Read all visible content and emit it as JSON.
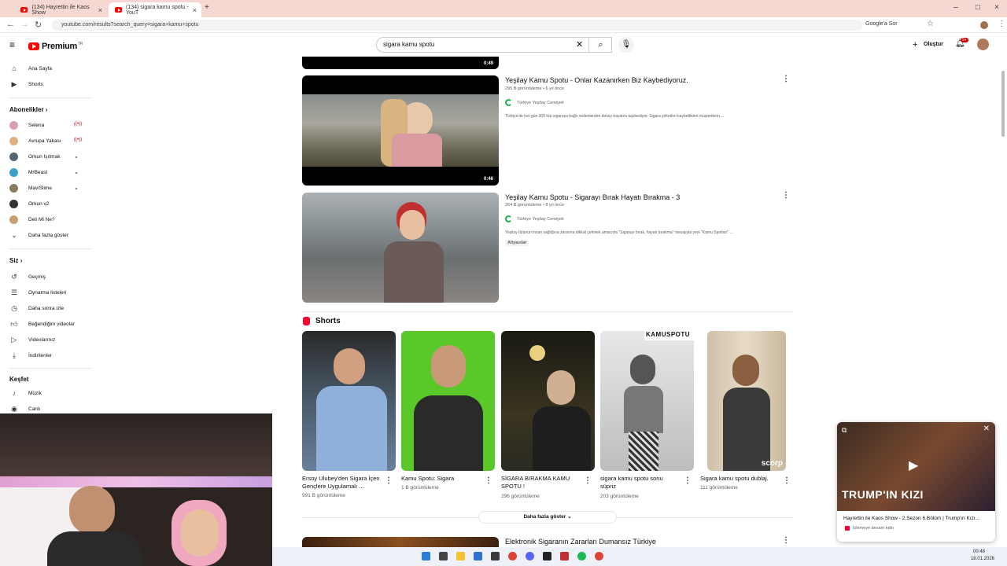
{
  "browser": {
    "tabs": [
      {
        "title": "(134) Hayrettin ile Kaos Show"
      },
      {
        "title": "(134) sigara kamu spotu - YouT"
      }
    ],
    "url": "youtube.com/results?search_query=sigara+kamu+spotu",
    "google_button": "Google'a Sor"
  },
  "header": {
    "logo_text": "Premium",
    "logo_badge": "TR",
    "search_value": "sigara kamu spotu",
    "create_label": "Oluştur",
    "notif_count": "9+"
  },
  "sidebar": {
    "top": [
      {
        "label": "Ana Sayfa",
        "icon": "home-icon"
      },
      {
        "label": "Shorts",
        "icon": "shorts-icon"
      }
    ],
    "subscriptions_heading": "Abonelikler",
    "subscriptions": [
      {
        "label": "Selena",
        "live": true,
        "color": "#d8a0b8"
      },
      {
        "label": "Avrupa Yakası",
        "live": true,
        "color": "#e0b080"
      },
      {
        "label": "Orkun Işıtmak",
        "live": false,
        "color": "#556677"
      },
      {
        "label": "MrBeast",
        "live": false,
        "color": "#3aa0c8"
      },
      {
        "label": "MaviSlime",
        "live": false,
        "color": "#8a7a60"
      },
      {
        "label": "Orkun v2",
        "live": false,
        "color": "#333"
      },
      {
        "label": "Deli Mi Ne?",
        "live": false,
        "color": "#c8a070"
      }
    ],
    "show_more": "Daha fazla göster",
    "you_heading": "Siz",
    "you_items": [
      {
        "label": "Geçmiş",
        "icon": "history-icon"
      },
      {
        "label": "Oynatma listeleri",
        "icon": "playlist-icon"
      },
      {
        "label": "Daha sonra izle",
        "icon": "clock-icon"
      },
      {
        "label": "Beğendiğim videolar",
        "icon": "like-icon"
      },
      {
        "label": "Videolarınız",
        "icon": "video-icon"
      },
      {
        "label": "İndirilenler",
        "icon": "download-icon"
      }
    ],
    "explore_heading": "Keşfet",
    "explore_items": [
      {
        "label": "Müzik",
        "icon": "music-icon"
      },
      {
        "label": "Canlı",
        "icon": "live-icon"
      }
    ]
  },
  "results": [
    {
      "duration": "0:49"
    },
    {
      "title": "Yeşilay Kamu Spotu - Onlar Kazanırken Biz Kaybediyoruz.",
      "meta": "295 B görüntüleme • 6 yıl önce",
      "channel": "Türkiye Yeşilay Cemiyeti",
      "description": "Türkiye'de her gün 300 kişi sigaraya bağlı nedenlerden dolayı hayatını kaybediyor. Sigara şirketleri kaybettikleri müşterilerin ...",
      "duration": "0:46"
    },
    {
      "title": "Yeşilay Kamu Spotu - Sigarayı Bırak Hayatı Bırakma - 3",
      "meta": "264 B görüntüleme • 8 yıl önce",
      "channel": "Türkiye Yeşilay Cemiyeti",
      "description": "Yeşilay tütünün insan sağlığına zararına dikkat çekmek amacıyla \"Sigarayı bırak, hayatı bırakma\" mesajıyla yeni \"Kamu Spotları\" ...",
      "badge": "Altyazılar"
    }
  ],
  "shorts": {
    "heading": "Shorts",
    "items": [
      {
        "title": "Ersoy Ulubey'den Sigara İçen Gençlere Uygulamalı ...",
        "views": "991 B görüntüleme"
      },
      {
        "title": "Kamu Spotu: Sigara",
        "views": "1 B görüntüleme"
      },
      {
        "title": "SİGARA BIRAKMA KAMU SPOTU !",
        "views": "296 görüntüleme"
      },
      {
        "title": "sigara kamu spotu sonu süpriz",
        "views": "203 görüntüleme"
      },
      {
        "title": "Sigara kamu spotu dublaj.",
        "views": "111 görüntüleme"
      }
    ],
    "show_more": "Daha fazla göster",
    "short4_caption": "KAMUSPOTU",
    "short5_watermark": "scorp"
  },
  "next_result": {
    "title": "Elektronik Sigaranın Zararları Dumansız Türkiye"
  },
  "miniplayer": {
    "title": "Hayrettin ile Kaos Show - 2.Sezon 6.Bölüm | Trump'ın Kızı...",
    "subtitle": "İzlemeye devam edin",
    "overlay_text": "TRUMP'IN KIZI"
  },
  "taskbar": {
    "time": "00:48",
    "date": "18.01.2026"
  }
}
